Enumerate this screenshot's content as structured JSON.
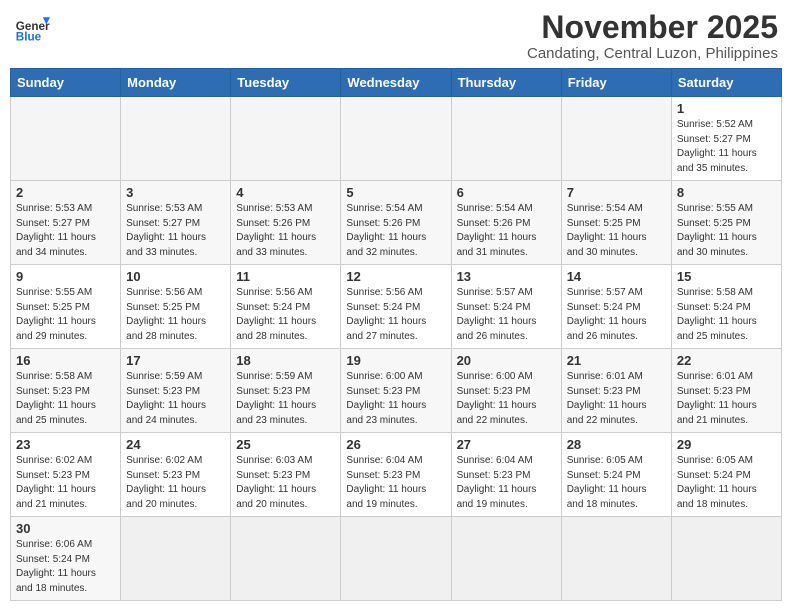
{
  "header": {
    "logo_general": "General",
    "logo_blue": "Blue",
    "month_year": "November 2025",
    "location": "Candating, Central Luzon, Philippines"
  },
  "days_of_week": [
    "Sunday",
    "Monday",
    "Tuesday",
    "Wednesday",
    "Thursday",
    "Friday",
    "Saturday"
  ],
  "weeks": [
    [
      {
        "day": "",
        "info": ""
      },
      {
        "day": "",
        "info": ""
      },
      {
        "day": "",
        "info": ""
      },
      {
        "day": "",
        "info": ""
      },
      {
        "day": "",
        "info": ""
      },
      {
        "day": "",
        "info": ""
      },
      {
        "day": "1",
        "info": "Sunrise: 5:52 AM\nSunset: 5:27 PM\nDaylight: 11 hours\nand 35 minutes."
      }
    ],
    [
      {
        "day": "2",
        "info": "Sunrise: 5:53 AM\nSunset: 5:27 PM\nDaylight: 11 hours\nand 34 minutes."
      },
      {
        "day": "3",
        "info": "Sunrise: 5:53 AM\nSunset: 5:27 PM\nDaylight: 11 hours\nand 33 minutes."
      },
      {
        "day": "4",
        "info": "Sunrise: 5:53 AM\nSunset: 5:26 PM\nDaylight: 11 hours\nand 33 minutes."
      },
      {
        "day": "5",
        "info": "Sunrise: 5:54 AM\nSunset: 5:26 PM\nDaylight: 11 hours\nand 32 minutes."
      },
      {
        "day": "6",
        "info": "Sunrise: 5:54 AM\nSunset: 5:26 PM\nDaylight: 11 hours\nand 31 minutes."
      },
      {
        "day": "7",
        "info": "Sunrise: 5:54 AM\nSunset: 5:25 PM\nDaylight: 11 hours\nand 30 minutes."
      },
      {
        "day": "8",
        "info": "Sunrise: 5:55 AM\nSunset: 5:25 PM\nDaylight: 11 hours\nand 30 minutes."
      }
    ],
    [
      {
        "day": "9",
        "info": "Sunrise: 5:55 AM\nSunset: 5:25 PM\nDaylight: 11 hours\nand 29 minutes."
      },
      {
        "day": "10",
        "info": "Sunrise: 5:56 AM\nSunset: 5:25 PM\nDaylight: 11 hours\nand 28 minutes."
      },
      {
        "day": "11",
        "info": "Sunrise: 5:56 AM\nSunset: 5:24 PM\nDaylight: 11 hours\nand 28 minutes."
      },
      {
        "day": "12",
        "info": "Sunrise: 5:56 AM\nSunset: 5:24 PM\nDaylight: 11 hours\nand 27 minutes."
      },
      {
        "day": "13",
        "info": "Sunrise: 5:57 AM\nSunset: 5:24 PM\nDaylight: 11 hours\nand 26 minutes."
      },
      {
        "day": "14",
        "info": "Sunrise: 5:57 AM\nSunset: 5:24 PM\nDaylight: 11 hours\nand 26 minutes."
      },
      {
        "day": "15",
        "info": "Sunrise: 5:58 AM\nSunset: 5:24 PM\nDaylight: 11 hours\nand 25 minutes."
      }
    ],
    [
      {
        "day": "16",
        "info": "Sunrise: 5:58 AM\nSunset: 5:23 PM\nDaylight: 11 hours\nand 25 minutes."
      },
      {
        "day": "17",
        "info": "Sunrise: 5:59 AM\nSunset: 5:23 PM\nDaylight: 11 hours\nand 24 minutes."
      },
      {
        "day": "18",
        "info": "Sunrise: 5:59 AM\nSunset: 5:23 PM\nDaylight: 11 hours\nand 23 minutes."
      },
      {
        "day": "19",
        "info": "Sunrise: 6:00 AM\nSunset: 5:23 PM\nDaylight: 11 hours\nand 23 minutes."
      },
      {
        "day": "20",
        "info": "Sunrise: 6:00 AM\nSunset: 5:23 PM\nDaylight: 11 hours\nand 22 minutes."
      },
      {
        "day": "21",
        "info": "Sunrise: 6:01 AM\nSunset: 5:23 PM\nDaylight: 11 hours\nand 22 minutes."
      },
      {
        "day": "22",
        "info": "Sunrise: 6:01 AM\nSunset: 5:23 PM\nDaylight: 11 hours\nand 21 minutes."
      }
    ],
    [
      {
        "day": "23",
        "info": "Sunrise: 6:02 AM\nSunset: 5:23 PM\nDaylight: 11 hours\nand 21 minutes."
      },
      {
        "day": "24",
        "info": "Sunrise: 6:02 AM\nSunset: 5:23 PM\nDaylight: 11 hours\nand 20 minutes."
      },
      {
        "day": "25",
        "info": "Sunrise: 6:03 AM\nSunset: 5:23 PM\nDaylight: 11 hours\nand 20 minutes."
      },
      {
        "day": "26",
        "info": "Sunrise: 6:04 AM\nSunset: 5:23 PM\nDaylight: 11 hours\nand 19 minutes."
      },
      {
        "day": "27",
        "info": "Sunrise: 6:04 AM\nSunset: 5:23 PM\nDaylight: 11 hours\nand 19 minutes."
      },
      {
        "day": "28",
        "info": "Sunrise: 6:05 AM\nSunset: 5:24 PM\nDaylight: 11 hours\nand 18 minutes."
      },
      {
        "day": "29",
        "info": "Sunrise: 6:05 AM\nSunset: 5:24 PM\nDaylight: 11 hours\nand 18 minutes."
      }
    ],
    [
      {
        "day": "30",
        "info": "Sunrise: 6:06 AM\nSunset: 5:24 PM\nDaylight: 11 hours\nand 18 minutes."
      },
      {
        "day": "",
        "info": ""
      },
      {
        "day": "",
        "info": ""
      },
      {
        "day": "",
        "info": ""
      },
      {
        "day": "",
        "info": ""
      },
      {
        "day": "",
        "info": ""
      },
      {
        "day": "",
        "info": ""
      }
    ]
  ]
}
